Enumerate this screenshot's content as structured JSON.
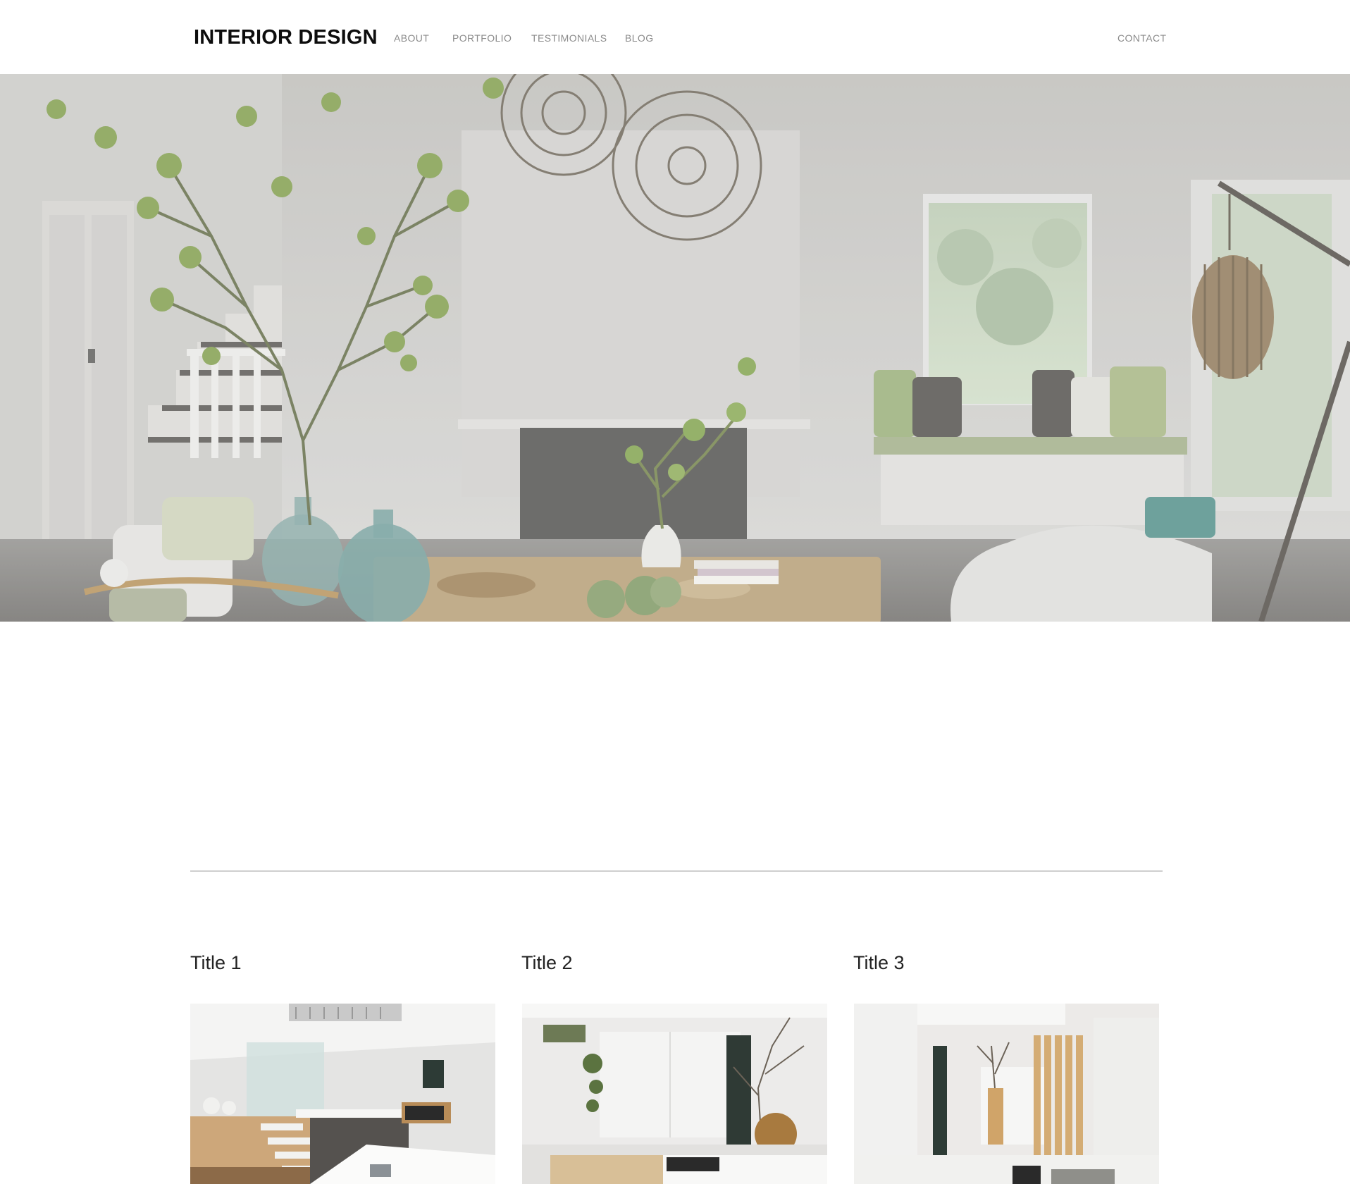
{
  "header": {
    "brand": "INTERIOR DESIGN",
    "nav": {
      "about": "ABOUT",
      "portfolio": "PORTFOLIO",
      "testimonials": "TESTIMONIALS",
      "blog": "BLOG",
      "contact": "CONTACT"
    }
  },
  "hero": {
    "image": "living-room-photo"
  },
  "cards": [
    {
      "title": "Title 1",
      "image": "kitchen-stairs-photo"
    },
    {
      "title": "Title 2",
      "image": "entry-hall-photo"
    },
    {
      "title": "Title 3",
      "image": "corridor-slat-divider-photo"
    }
  ],
  "colors": {
    "nav_text": "#8a8a8a",
    "brand_text": "#0d0d0d",
    "divider": "#cfcfcf",
    "background": "#ffffff"
  }
}
